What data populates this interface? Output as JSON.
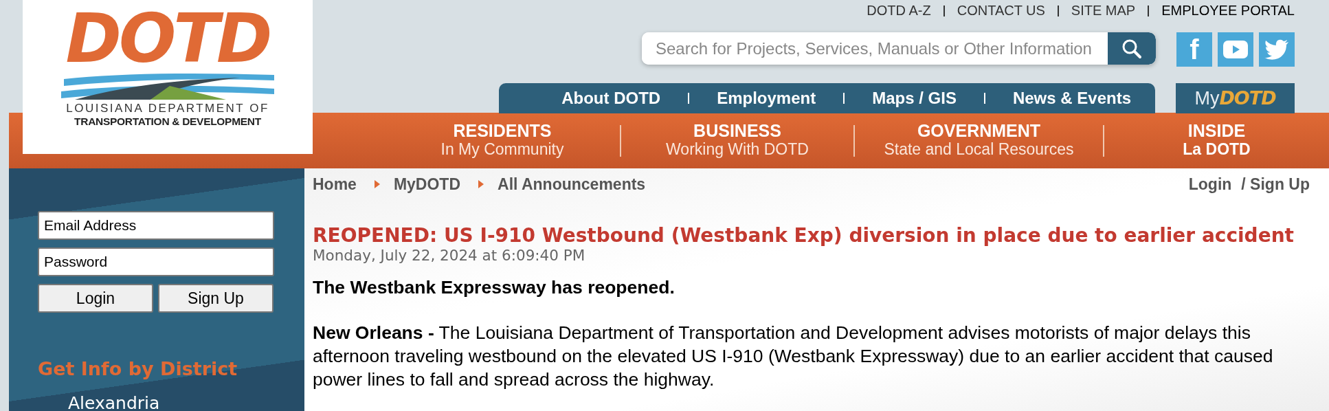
{
  "logo": {
    "wordmark": "DOTD",
    "line1": "LOUISIANA DEPARTMENT OF",
    "line2": "TRANSPORTATION & DEVELOPMENT"
  },
  "utility_links": [
    {
      "label": "DOTD A-Z",
      "kind": "normal"
    },
    {
      "label": "CONTACT US",
      "kind": "normal"
    },
    {
      "label": "SITE MAP",
      "kind": "normal"
    },
    {
      "label": "EMPLOYEE PORTAL",
      "kind": "emphasis"
    }
  ],
  "search": {
    "placeholder": "Search for Projects, Services, Manuals or Other Information"
  },
  "social": [
    {
      "kind": "facebook",
      "glyph": "f"
    },
    {
      "kind": "youtube"
    },
    {
      "kind": "twitter"
    }
  ],
  "top_nav": [
    "About DOTD",
    "Employment",
    "Maps / GIS",
    "News & Events"
  ],
  "mydotd": {
    "prefix": "My",
    "wordmark": "DOTD"
  },
  "audience_nav": [
    {
      "title": "RESIDENTS",
      "subtitle": "In My Community"
    },
    {
      "title": "BUSINESS",
      "subtitle": "Working With DOTD"
    },
    {
      "title": "GOVERNMENT",
      "subtitle": "State and Local Resources"
    },
    {
      "title": "INSIDE",
      "subtitle": "La DOTD",
      "subtitle_bold": true
    }
  ],
  "sidebar": {
    "email": {
      "placeholder": "Email Address"
    },
    "password": {
      "placeholder": "Password"
    },
    "buttons": [
      "Login",
      "Sign Up"
    ],
    "heading": "Get Info by District",
    "districts": [
      "Alexandria"
    ]
  },
  "breadcrumb": [
    "Home",
    "MyDOTD",
    "All Announcements"
  ],
  "account_links": [
    "Login",
    "/ Sign Up"
  ],
  "article": {
    "title": "REOPENED: US I-910 Westbound (Westbank Exp) diversion in place due to earlier accident",
    "date": "Monday, July 22, 2024 at 6:09:40 PM",
    "lead": "The Westbank Expressway has reopened.",
    "body": "**New Orleans -** The Louisiana Department of Transportation and Development advises motorists of major delays this afternoon traveling westbound on the elevated US I-910 (Westbank Expressway) due to an earlier accident that caused power lines to fall and spread across the highway."
  }
}
